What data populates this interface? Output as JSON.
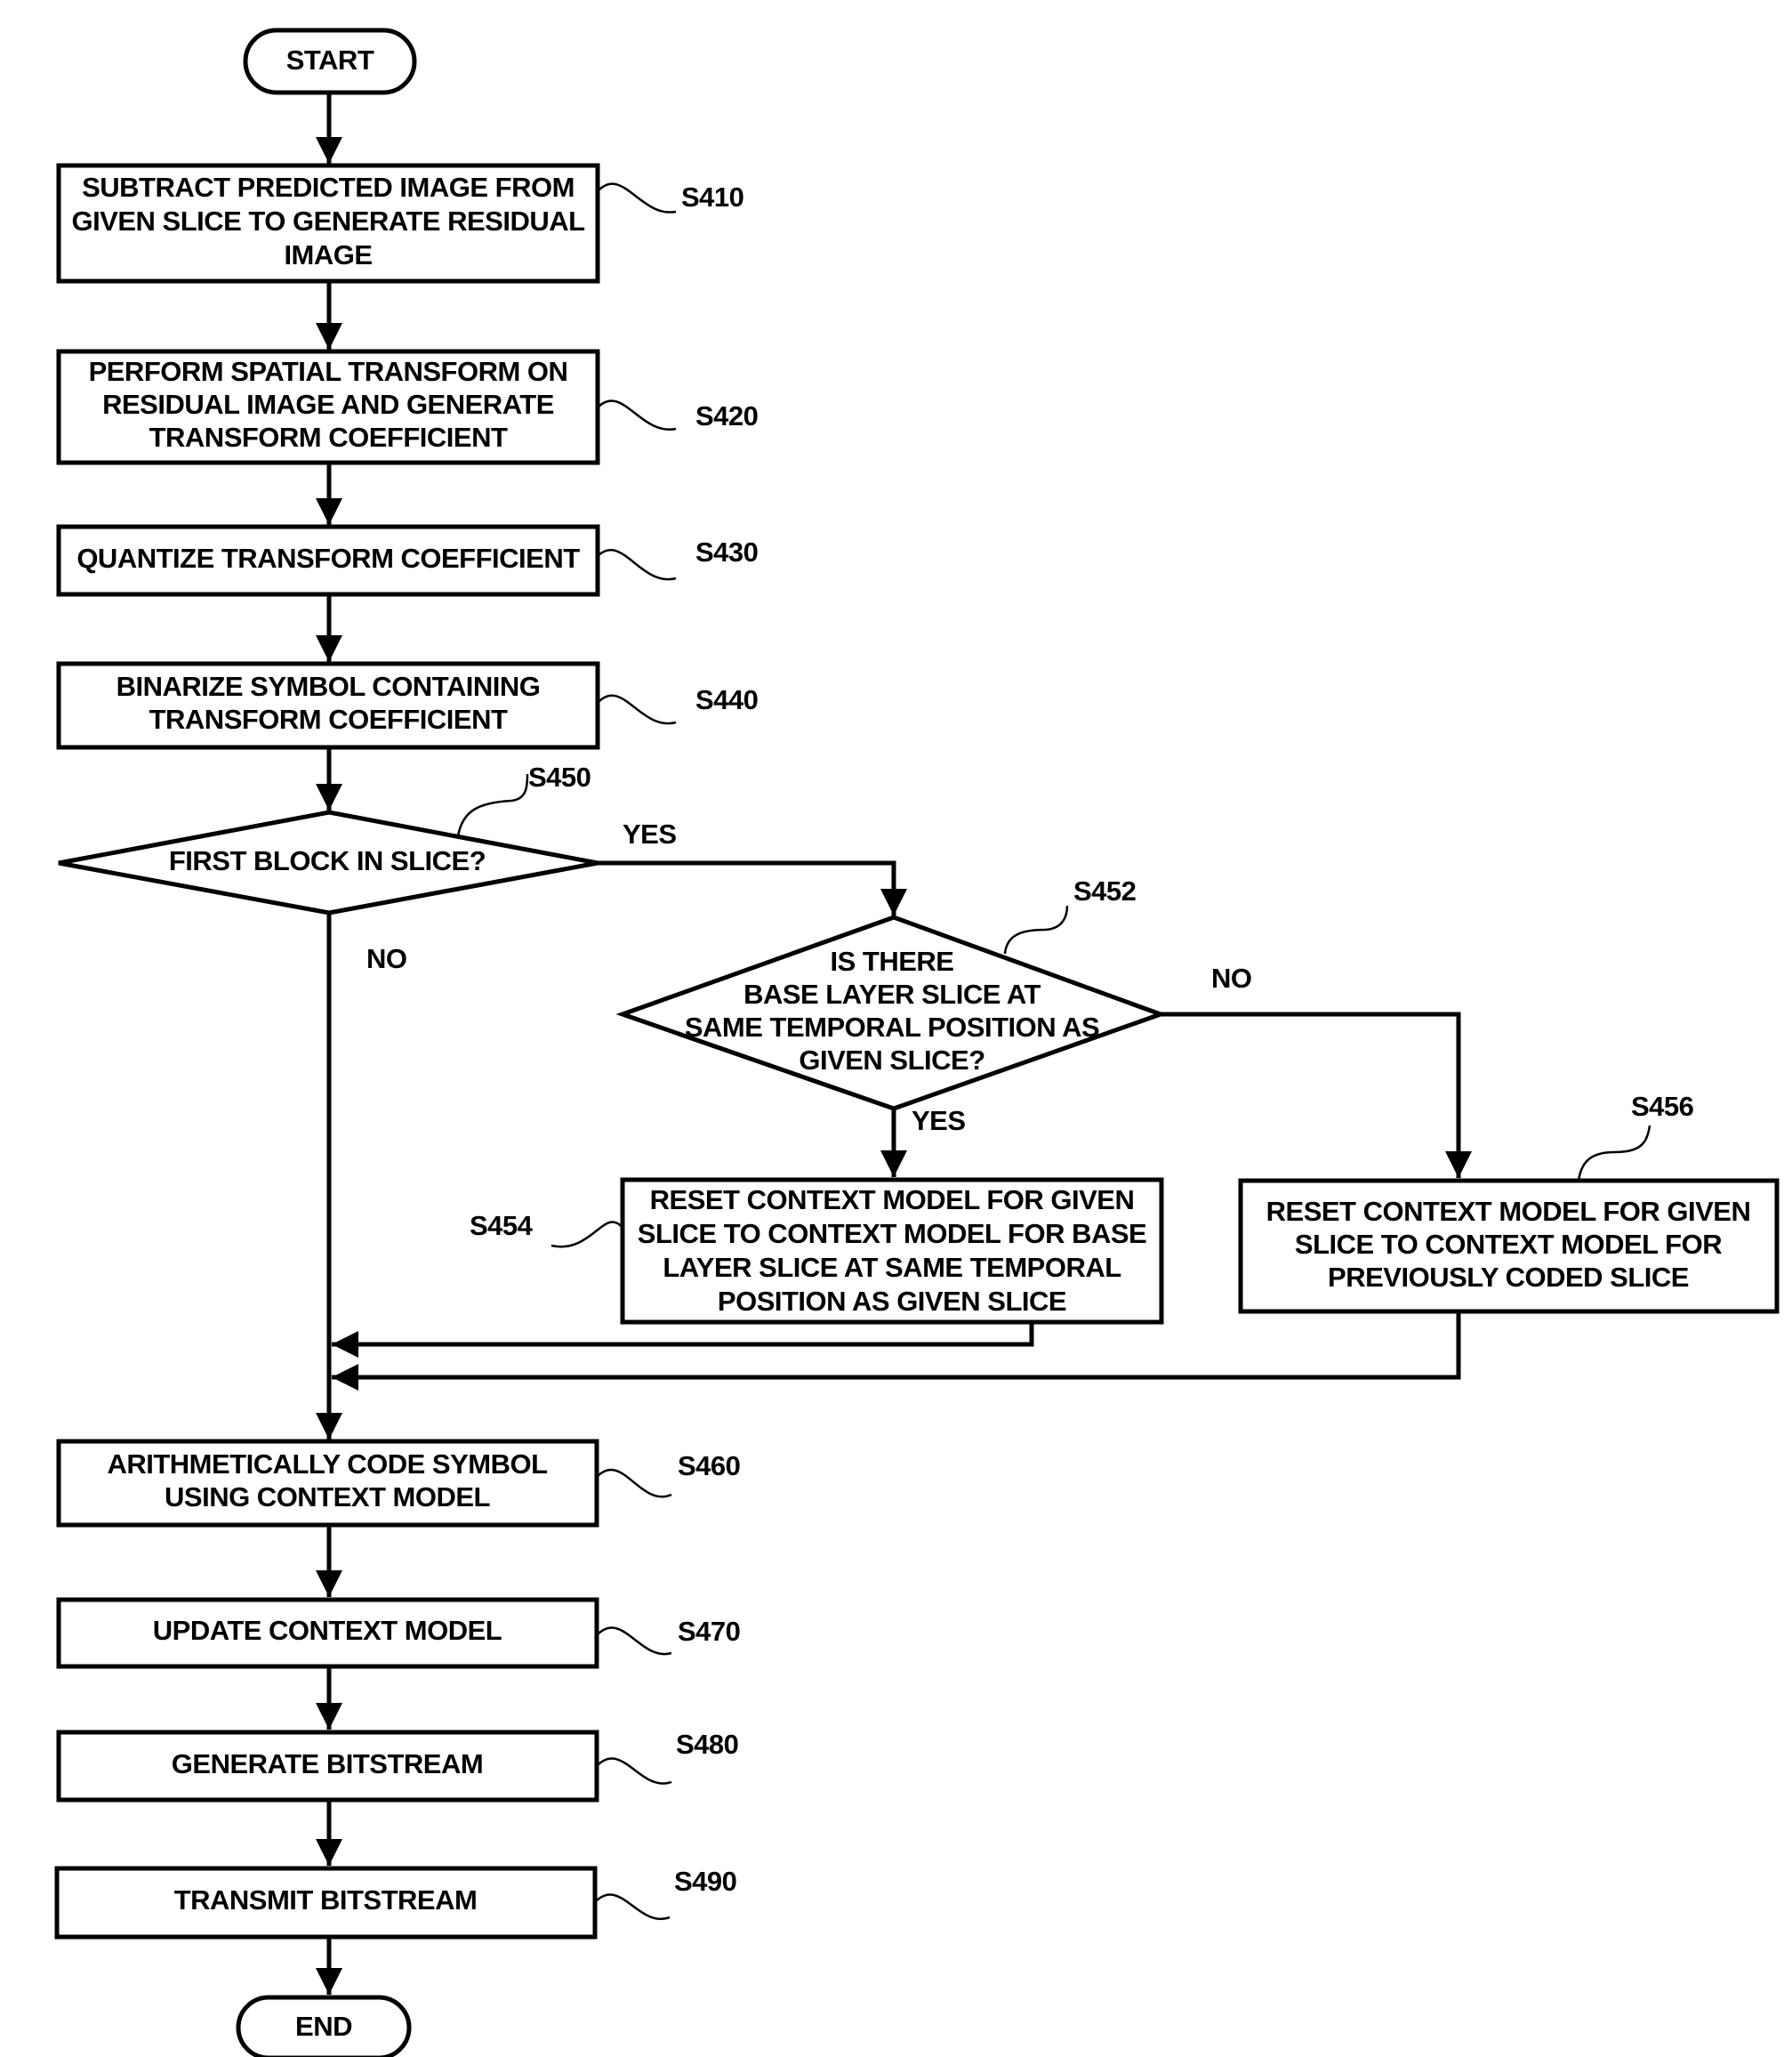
{
  "diagram": {
    "type": "flowchart",
    "colors": {
      "stroke": "#000000",
      "background": "#ffffff"
    },
    "terminals": {
      "start": "START",
      "end": "END"
    },
    "steps": [
      {
        "id": "S410",
        "lines": [
          "SUBTRACT PREDICTED IMAGE FROM",
          "GIVEN SLICE TO GENERATE RESIDUAL",
          "IMAGE"
        ]
      },
      {
        "id": "S420",
        "lines": [
          "PERFORM SPATIAL TRANSFORM ON",
          "RESIDUAL IMAGE AND GENERATE",
          "TRANSFORM COEFFICIENT"
        ]
      },
      {
        "id": "S430",
        "lines": [
          "QUANTIZE TRANSFORM COEFFICIENT"
        ]
      },
      {
        "id": "S440",
        "lines": [
          "BINARIZE SYMBOL CONTAINING",
          "TRANSFORM COEFFICIENT"
        ]
      },
      {
        "id": "S450",
        "lines": [
          "FIRST BLOCK IN SLICE?"
        ]
      },
      {
        "id": "S452",
        "lines": [
          "IS THERE",
          "BASE LAYER SLICE AT",
          "SAME TEMPORAL POSITION AS",
          "GIVEN SLICE?"
        ]
      },
      {
        "id": "S454",
        "lines": [
          "RESET CONTEXT MODEL FOR GIVEN",
          "SLICE TO CONTEXT MODEL FOR BASE",
          "LAYER SLICE AT SAME TEMPORAL",
          "POSITION AS GIVEN SLICE"
        ]
      },
      {
        "id": "S456",
        "lines": [
          "RESET CONTEXT MODEL FOR GIVEN",
          "SLICE TO CONTEXT MODEL FOR",
          "PREVIOUSLY CODED SLICE"
        ]
      },
      {
        "id": "S460",
        "lines": [
          "ARITHMETICALLY CODE SYMBOL",
          "USING CONTEXT MODEL"
        ]
      },
      {
        "id": "S470",
        "lines": [
          "UPDATE CONTEXT MODEL"
        ]
      },
      {
        "id": "S480",
        "lines": [
          "GENERATE BITSTREAM"
        ]
      },
      {
        "id": "S490",
        "lines": [
          "TRANSMIT BITSTREAM"
        ]
      }
    ],
    "branch_labels": {
      "s450_yes": "YES",
      "s450_no": "NO",
      "s452_yes": "YES",
      "s452_no": "NO"
    }
  }
}
